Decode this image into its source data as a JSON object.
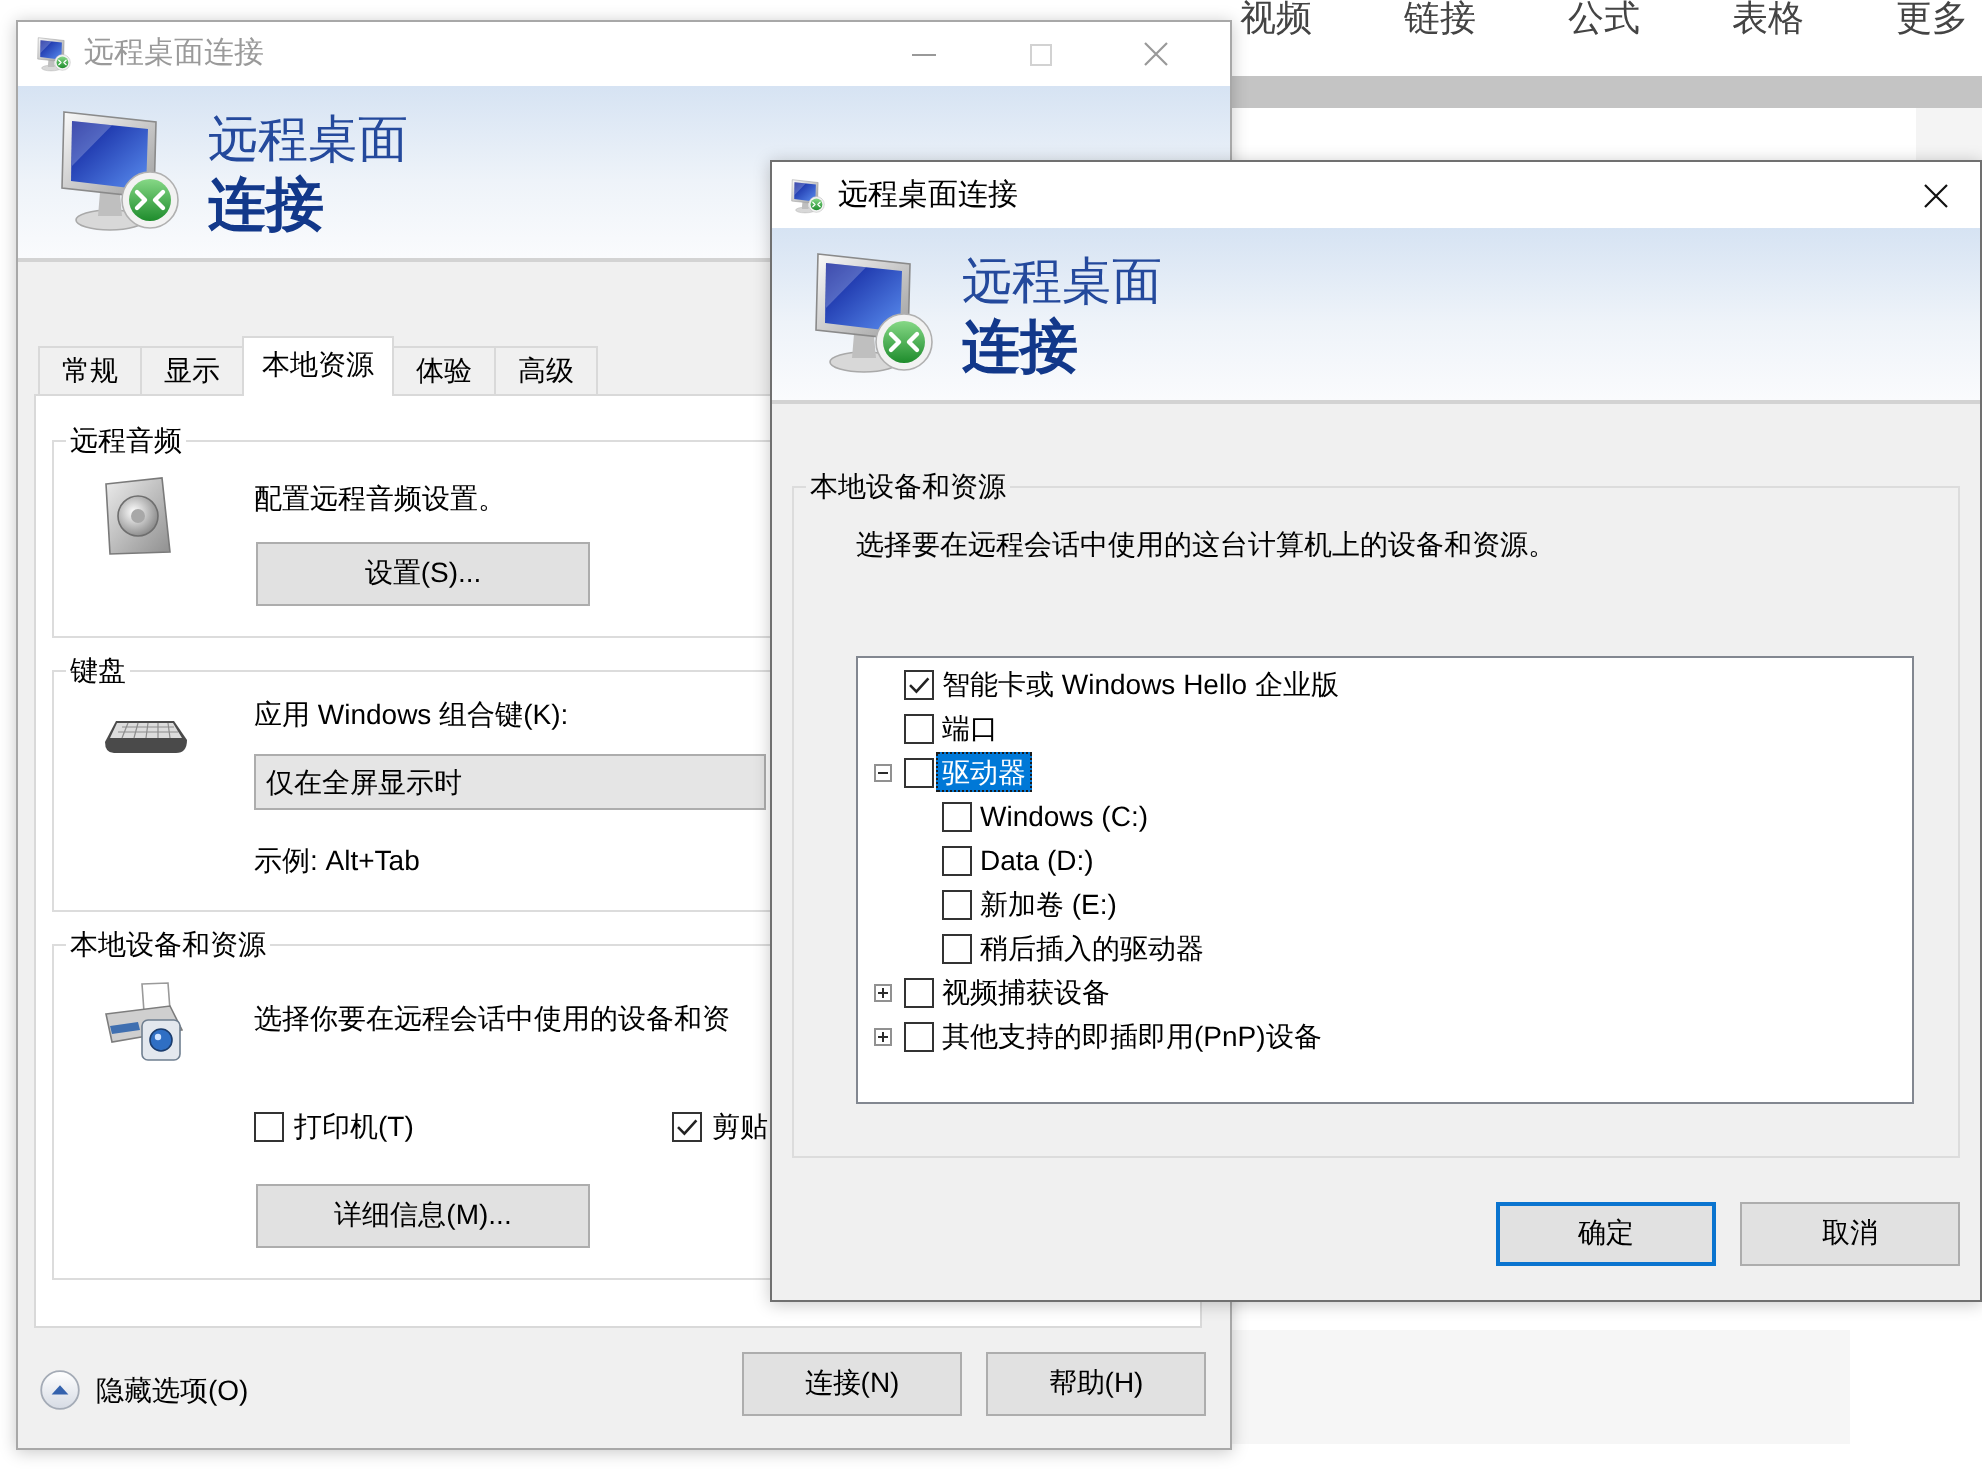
{
  "page": {
    "toolbar": [
      "视频",
      "链接",
      "公式",
      "表格",
      "更多"
    ]
  },
  "main_window": {
    "title": "远程桌面连接",
    "active": false,
    "maximize_disabled": true,
    "banner": {
      "line_1": "远程桌面",
      "line_2": "连接"
    },
    "tabs": [
      {
        "label": "常规",
        "selected": false
      },
      {
        "label": "显示",
        "selected": false
      },
      {
        "label": "本地资源",
        "selected": true
      },
      {
        "label": "体验",
        "selected": false
      },
      {
        "label": "高级",
        "selected": false
      }
    ],
    "groups": [
      {
        "kind": "audio",
        "title": "远程音频",
        "text": "配置远程音频设置。",
        "button": "设置(S)..."
      },
      {
        "kind": "keyboard",
        "title": "键盘",
        "label": "应用 Windows 组合键(K):",
        "dropdown": {
          "value": "仅在全屏显示时"
        },
        "example": "示例: Alt+Tab"
      },
      {
        "kind": "devices",
        "title": "本地设备和资源",
        "text": "选择你要在远程会话中使用的设备和资",
        "checkboxes": [
          {
            "label": "打印机(T)",
            "checked": false
          },
          {
            "label": "剪贴",
            "checked": true
          }
        ],
        "button": "详细信息(M)..."
      }
    ],
    "options_toggle": "隐藏选项(O)",
    "buttons": [
      {
        "label": "连接(N)"
      },
      {
        "label": "帮助(H)"
      }
    ]
  },
  "device_window": {
    "title": "远程桌面连接",
    "active": true,
    "banner": {
      "line_1": "远程桌面",
      "line_2": "连接"
    },
    "group": {
      "title": "本地设备和资源",
      "text": "选择要在远程会话中使用的这台计算机上的设备和资源。",
      "tree": [
        {
          "label": "智能卡或 Windows Hello 企业版",
          "checked": true,
          "selected": false
        },
        {
          "label": "端口",
          "checked": false,
          "selected": false
        },
        {
          "label": "驱动器",
          "checked": false,
          "selected": true,
          "expanded": true,
          "children": [
            {
              "label": "Windows (C:)",
              "checked": false,
              "selected": false
            },
            {
              "label": "Data (D:)",
              "checked": false,
              "selected": false
            },
            {
              "label": "新加卷 (E:)",
              "checked": false,
              "selected": false
            },
            {
              "label": "稍后插入的驱动器",
              "checked": false,
              "selected": false
            }
          ]
        },
        {
          "label": "视频捕获设备",
          "checked": false,
          "selected": false,
          "expanded": false
        },
        {
          "label": "其他支持的即插即用(PnP)设备",
          "checked": false,
          "selected": false,
          "expanded": false
        }
      ]
    },
    "buttons": [
      {
        "label": "确定",
        "default": true
      },
      {
        "label": "取消",
        "default": false
      }
    ]
  }
}
